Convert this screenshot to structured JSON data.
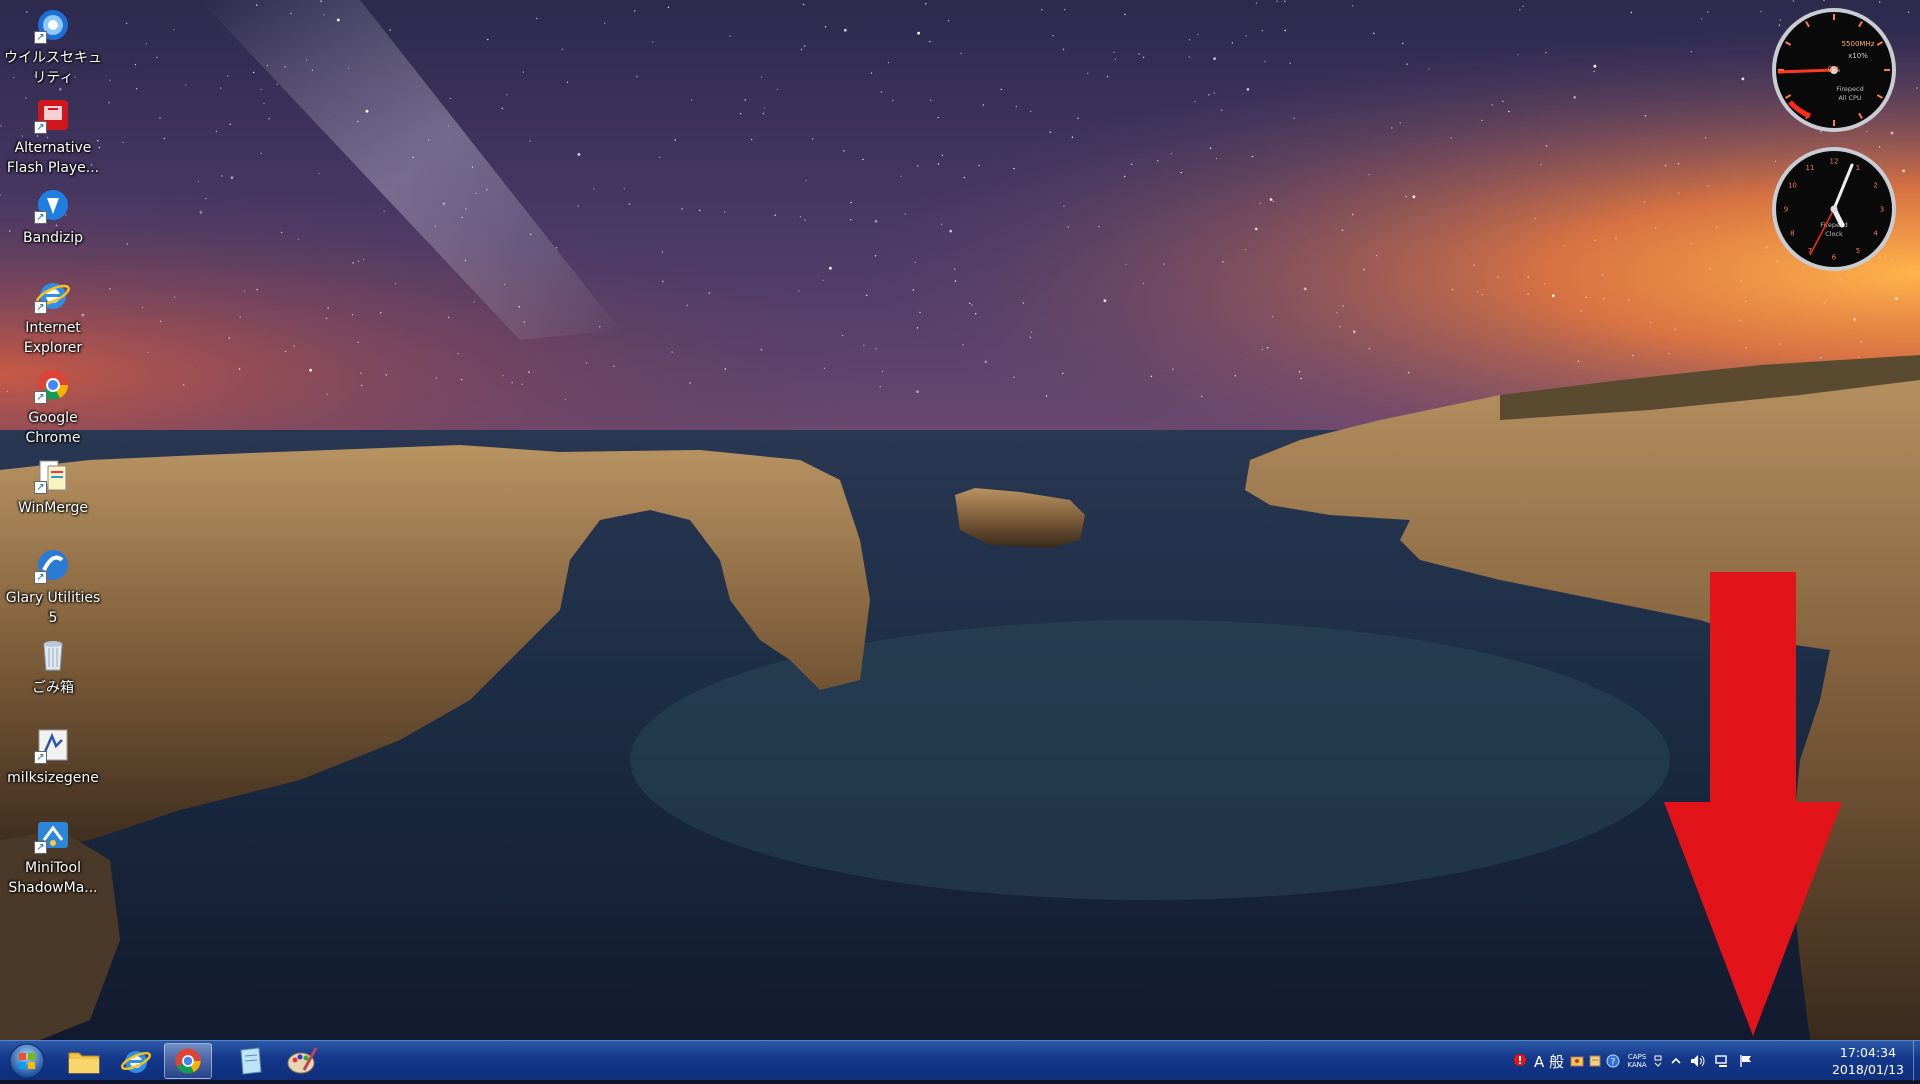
{
  "desktop": {
    "icons": [
      {
        "label": "ウイルスセキュ\nリティ",
        "icon": "virus-security-icon"
      },
      {
        "label": "Alternative\nFlash Playe...",
        "icon": "flash-player-icon"
      },
      {
        "label": "Bandizip",
        "icon": "bandizip-icon"
      },
      {
        "label": "Internet\nExplorer",
        "icon": "internet-explorer-icon"
      },
      {
        "label": "Google\nChrome",
        "icon": "chrome-icon"
      },
      {
        "label": "WinMerge",
        "icon": "winmerge-icon"
      },
      {
        "label": "Glary Utilities\n5",
        "icon": "glary-utilities-icon"
      },
      {
        "label": "ごみ箱",
        "icon": "recycle-bin-icon"
      },
      {
        "label": "milksizegene",
        "icon": "milksizegene-icon"
      },
      {
        "label": "MiniTool\nShadowMa...",
        "icon": "minitool-icon"
      }
    ]
  },
  "gadgets": {
    "cpu": {
      "freq": "5500MHz",
      "multiplier": "x10%",
      "usage": "0%",
      "name_line1": "Firepecd",
      "name_line2": "All CPU"
    },
    "clock": {
      "name_line1": "Firepecd",
      "name_line2": "Clock"
    }
  },
  "taskbar": {
    "apps": [
      "start-orb",
      "explorer",
      "internet-explorer",
      "chrome",
      "notepad-app",
      "paint-app"
    ],
    "tray": {
      "ime_mode": "A 般",
      "caps": "CAPS",
      "kana": "KANA"
    },
    "clock": {
      "time": "17:04:34",
      "date": "2018/01/13"
    }
  },
  "colors": {
    "taskbar": "#14378a",
    "arrow": "#e3131a",
    "gadget_accent": "#ff2a1a"
  }
}
